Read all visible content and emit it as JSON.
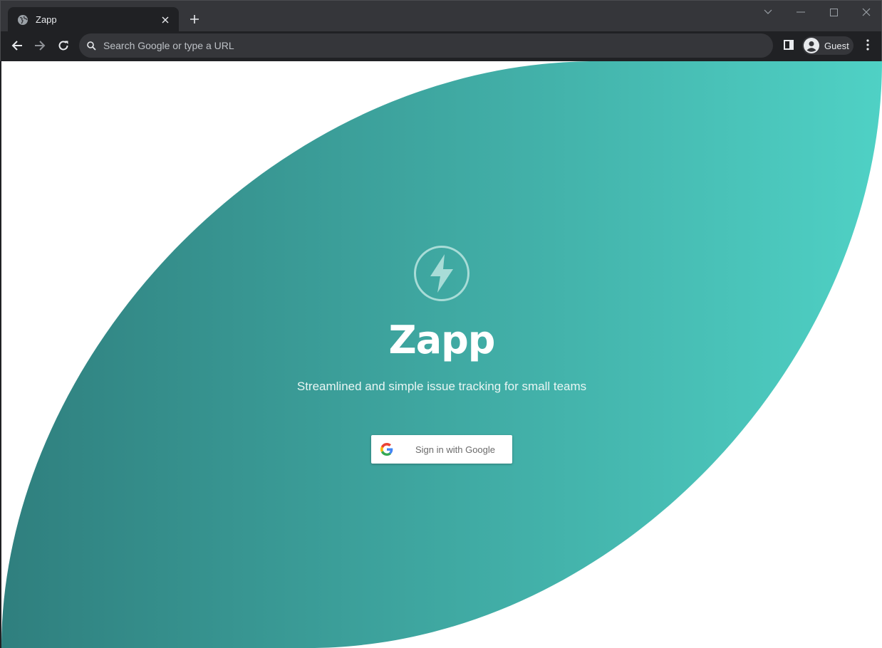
{
  "browser": {
    "tab": {
      "title": "Zapp"
    },
    "omnibox": {
      "placeholder": "Search Google or type a URL"
    },
    "profile": {
      "label": "Guest"
    }
  },
  "page": {
    "title": "Zapp",
    "subtitle": "Streamlined and simple issue tracking for small teams",
    "signin_label": "Sign in with Google"
  },
  "colors": {
    "chrome_dark": "#202124",
    "chrome_tab_strip": "#35363a",
    "gradient_start": "#2f7f7e",
    "gradient_end": "#4fd1c5",
    "page_background": "#ffffff"
  },
  "icons": {
    "favicon": "globe-icon",
    "hero_logo": "lightning-bolt-icon",
    "signin_logo": "google-g-icon"
  }
}
